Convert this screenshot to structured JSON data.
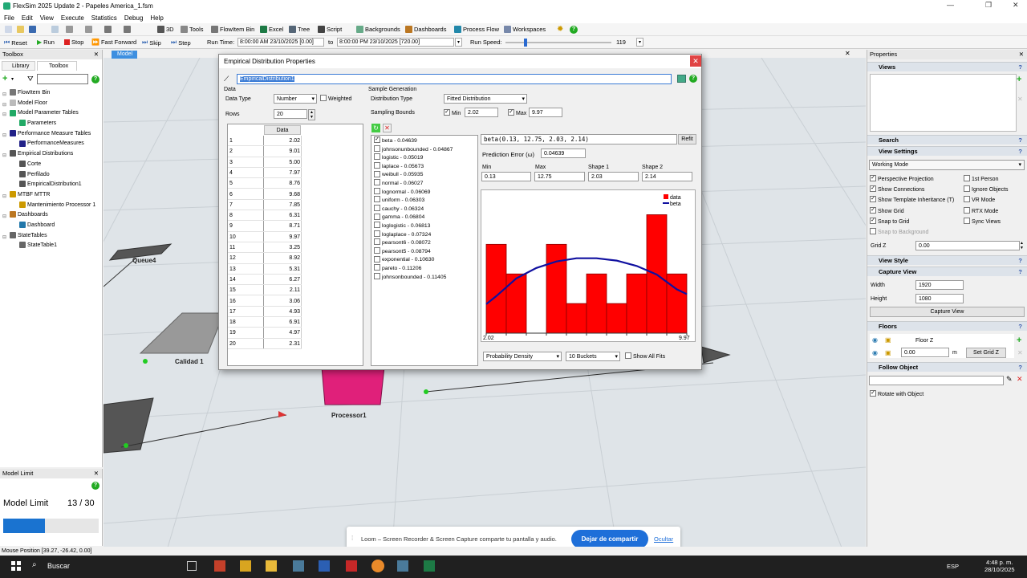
{
  "app": {
    "title": "FlexSim 2025 Update 2 - Papeles America_1.fsm"
  },
  "menu": [
    "File",
    "Edit",
    "View",
    "Execute",
    "Statistics",
    "Debug",
    "Help"
  ],
  "toolbar": {
    "items": [
      "3D",
      "Tools",
      "FlowItem Bin",
      "Excel",
      "Tree",
      "Script",
      "Backgrounds",
      "Dashboards",
      "Process Flow",
      "Workspaces"
    ]
  },
  "runbar": {
    "reset": "Reset",
    "run": "Run",
    "stop": "Stop",
    "ffwd": "Fast Forward",
    "skip": "Skip",
    "step": "Step",
    "run_time_label": "Run Time:",
    "start_time": "8:00:00 AM  23/10/2025  [0.00]",
    "to_label": "to",
    "end_time": "8:00:00 PM  23/10/2025  [720.00]",
    "run_speed_label": "Run Speed:",
    "run_speed": "119"
  },
  "toolbox": {
    "header": "Toolbox",
    "tab_library": "Library",
    "tab_toolbox": "Toolbox",
    "items": [
      {
        "label": "FlowItem Bin",
        "indent": 0,
        "color": "#777"
      },
      {
        "label": "Model Floor",
        "indent": 0,
        "color": "#bbb"
      },
      {
        "label": "Model Parameter Tables",
        "indent": 0,
        "color": "#2a6"
      },
      {
        "label": "Parameters",
        "indent": 1,
        "color": "#2a6"
      },
      {
        "label": "Performance Measure Tables",
        "indent": 0,
        "color": "#228"
      },
      {
        "label": "PerformanceMeasures",
        "indent": 1,
        "color": "#228"
      },
      {
        "label": "Empirical Distributions",
        "indent": 0,
        "color": "#555"
      },
      {
        "label": "Corte",
        "indent": 1,
        "color": "#555"
      },
      {
        "label": "Perfilado",
        "indent": 1,
        "color": "#555"
      },
      {
        "label": "EmpiricalDistribution1",
        "indent": 1,
        "color": "#555"
      },
      {
        "label": "MTBF MTTR",
        "indent": 0,
        "color": "#c90"
      },
      {
        "label": "Mantenimiento Processor 1",
        "indent": 1,
        "color": "#c90"
      },
      {
        "label": "Dashboards",
        "indent": 0,
        "color": "#b72"
      },
      {
        "label": "Dashboard",
        "indent": 1,
        "color": "#27a"
      },
      {
        "label": "StateTables",
        "indent": 0,
        "color": "#666"
      },
      {
        "label": "StateTable1",
        "indent": 1,
        "color": "#666"
      }
    ]
  },
  "model_limit": {
    "header": "Model Limit",
    "label": "Model Limit",
    "value": "13 / 30",
    "progress": 0.4333
  },
  "viewport": {
    "tab": "Model",
    "labels": {
      "queue4": "Queue4",
      "calidad1": "Calidad 1",
      "processor1": "Processor1"
    }
  },
  "dialog": {
    "title": "Empirical Distribution Properties",
    "name": "EmpiricalDistribution1",
    "data_group": "Data",
    "data_type_label": "Data Type",
    "data_type": "Number",
    "weighted": "Weighted",
    "rows_label": "Rows",
    "rows": "20",
    "col_header": "Data",
    "values": [
      "2.02",
      "9.01",
      "5.00",
      "7.97",
      "8.76",
      "9.68",
      "7.85",
      "6.31",
      "8.71",
      "9.97",
      "3.25",
      "8.92",
      "5.31",
      "6.27",
      "2.11",
      "3.06",
      "4.93",
      "6.91",
      "4.97",
      "2.31"
    ],
    "sample_group": "Sample Generation",
    "dist_type_label": "Distribution Type",
    "dist_type": "Fitted Distribution",
    "bounds_label": "Sampling Bounds",
    "min_label": "Min",
    "min_val": "2.02",
    "max_label": "Max",
    "max_val": "9.97",
    "fits": [
      {
        "label": "beta - 0.04639",
        "checked": true
      },
      {
        "label": "johnsonunbounded - 0.04867",
        "checked": false
      },
      {
        "label": "logistic - 0.05019",
        "checked": false
      },
      {
        "label": "laplace - 0.05673",
        "checked": false
      },
      {
        "label": "weibull - 0.05935",
        "checked": false
      },
      {
        "label": "normal - 0.06027",
        "checked": false
      },
      {
        "label": "lognormal - 0.06069",
        "checked": false
      },
      {
        "label": "uniform - 0.06303",
        "checked": false
      },
      {
        "label": "cauchy - 0.06324",
        "checked": false
      },
      {
        "label": "gamma - 0.06804",
        "checked": false
      },
      {
        "label": "loglogistic - 0.06813",
        "checked": false
      },
      {
        "label": "loglaplace - 0.07324",
        "checked": false
      },
      {
        "label": "pearsont6 - 0.08072",
        "checked": false
      },
      {
        "label": "pearsont5 - 0.08794",
        "checked": false
      },
      {
        "label": "exponential - 0.10630",
        "checked": false
      },
      {
        "label": "pareto - 0.11206",
        "checked": false
      },
      {
        "label": "johnsonbounded - 0.11405",
        "checked": false
      }
    ],
    "expression": "beta(0.13, 12.75, 2.03, 2.14)",
    "refit": "Refit",
    "pred_error_label": "Prediction Error (ω)",
    "pred_error": "0.04639",
    "param_labels": [
      "Min",
      "Max",
      "Shape 1",
      "Shape 2"
    ],
    "param_values": [
      "0.13",
      "12.75",
      "2.03",
      "2.14"
    ],
    "chart_mode": "Probability Density",
    "buckets": "10 Buckets",
    "show_all_fits": "Show All Fits"
  },
  "chart_data": {
    "type": "bar",
    "x_min_label": "2.02",
    "x_max_label": "9.97",
    "legend": [
      "data",
      "beta"
    ],
    "legend_position": "top-right",
    "colors": {
      "data": "#ff0000",
      "beta": "#1010a0"
    },
    "bucket_values": [
      3,
      2,
      0,
      3,
      1,
      2,
      1,
      2,
      4,
      2
    ],
    "beta_curve": [
      1.25,
      1.85,
      2.2,
      2.42,
      2.53,
      2.53,
      2.45,
      2.27,
      1.98,
      1.48
    ]
  },
  "props": {
    "header": "Properties",
    "views": "Views",
    "search": "Search",
    "view_settings": "View Settings",
    "working_mode": "Working Mode",
    "checks_left": [
      {
        "label": "Perspective Projection",
        "checked": true
      },
      {
        "label": "Show Connections",
        "checked": true
      },
      {
        "label": "Show Template Inheritance (T)",
        "checked": true
      },
      {
        "label": "Show Grid",
        "checked": true
      },
      {
        "label": "Snap to Grid",
        "checked": true
      },
      {
        "label": "Snap to Background",
        "checked": false
      }
    ],
    "checks_right": [
      {
        "label": "1st Person",
        "checked": false
      },
      {
        "label": "Ignore Objects",
        "checked": false
      },
      {
        "label": "VR Mode",
        "checked": false
      },
      {
        "label": "RTX Mode",
        "checked": false
      },
      {
        "label": "Sync Views",
        "checked": false
      }
    ],
    "grid_z_label": "Grid Z",
    "grid_z": "0.00",
    "view_style": "View Style",
    "capture_view": "Capture View",
    "width_label": "Width",
    "width": "1920",
    "height_label": "Height",
    "height": "1080",
    "capture_button": "Capture View",
    "floors": "Floors",
    "floor_name": "Floor Z",
    "floor_z": "0.00",
    "floor_unit": "m",
    "set_grid_z": "Set Grid Z",
    "follow_object": "Follow Object",
    "rotate_with_object": "Rotate with Object"
  },
  "loom": {
    "text": "Loom – Screen Recorder & Screen Capture comparte tu pantalla y audio.",
    "share": "Dejar de compartir",
    "hide": "Ocultar"
  },
  "status": {
    "mouse_position": "Mouse Position [39.27, -26.42, 0.00]"
  },
  "taskbar": {
    "search": "Buscar",
    "lang": "ESP",
    "time": "4:48 p. m.",
    "date": "28/10/2025"
  }
}
